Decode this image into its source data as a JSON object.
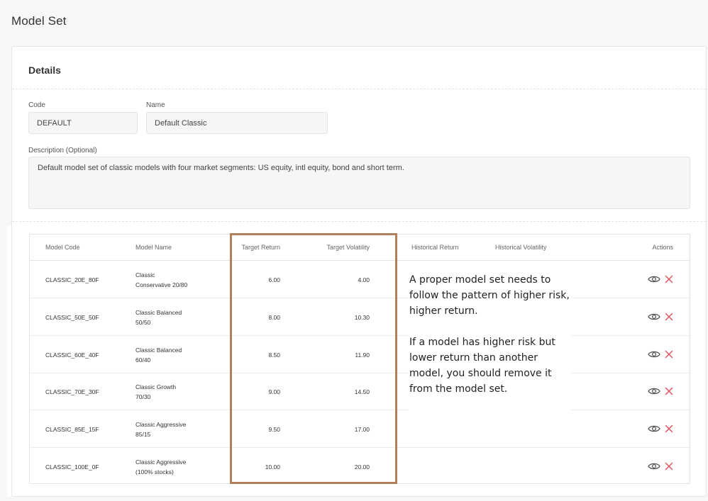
{
  "page": {
    "title": "Model Set"
  },
  "details": {
    "title": "Details",
    "code_label": "Code",
    "code_value": "DEFAULT",
    "name_label": "Name",
    "name_value": "Default Classic",
    "description_label": "Description (Optional)",
    "description_value": "Default model set of  classic models with four market segments: US equity, intl equity, bond and short term."
  },
  "table": {
    "headers": {
      "model_code": "Model Code",
      "model_name": "Model Name",
      "target_return": "Target Return",
      "target_volatility": "Target Volatility",
      "historical_return": "Historical Return",
      "historical_volatility": "Historical Volatility",
      "actions": "Actions"
    },
    "rows": [
      {
        "code": "CLASSIC_20E_80F",
        "name_line1": "Classic",
        "name_line2": "Conservative 20/80",
        "target_return": "6.00",
        "target_volatility": "4.00"
      },
      {
        "code": "CLASSIC_50E_50F",
        "name_line1": "Classic Balanced",
        "name_line2": "50/50",
        "target_return": "8.00",
        "target_volatility": "10.30"
      },
      {
        "code": "CLASSIC_60E_40F",
        "name_line1": "Classic Balanced",
        "name_line2": "60/40",
        "target_return": "8.50",
        "target_volatility": "11.90"
      },
      {
        "code": "CLASSIC_70E_30F",
        "name_line1": "Classic Growth",
        "name_line2": "70/30",
        "target_return": "9.00",
        "target_volatility": "14.50"
      },
      {
        "code": "CLASSIC_85E_15F",
        "name_line1": "Classic Aggressive",
        "name_line2": "85/15",
        "target_return": "9.50",
        "target_volatility": "17.00"
      },
      {
        "code": "CLASSIC_100E_0F",
        "name_line1": "Classic Aggressive",
        "name_line2": "(100% stocks)",
        "target_return": "10.00",
        "target_volatility": "20.00"
      }
    ],
    "action_icons": [
      "eye-icon",
      "close-icon"
    ]
  },
  "annotation": {
    "paragraph1": "A proper model set needs to follow the pattern of higher risk, higher return.",
    "paragraph2": "If a model has higher risk but lower return than another model, you should remove it from the model set.",
    "highlight_color": "#b17f5a"
  },
  "colors": {
    "delete_icon": "#e0525f",
    "eye_icon": "#555555"
  }
}
